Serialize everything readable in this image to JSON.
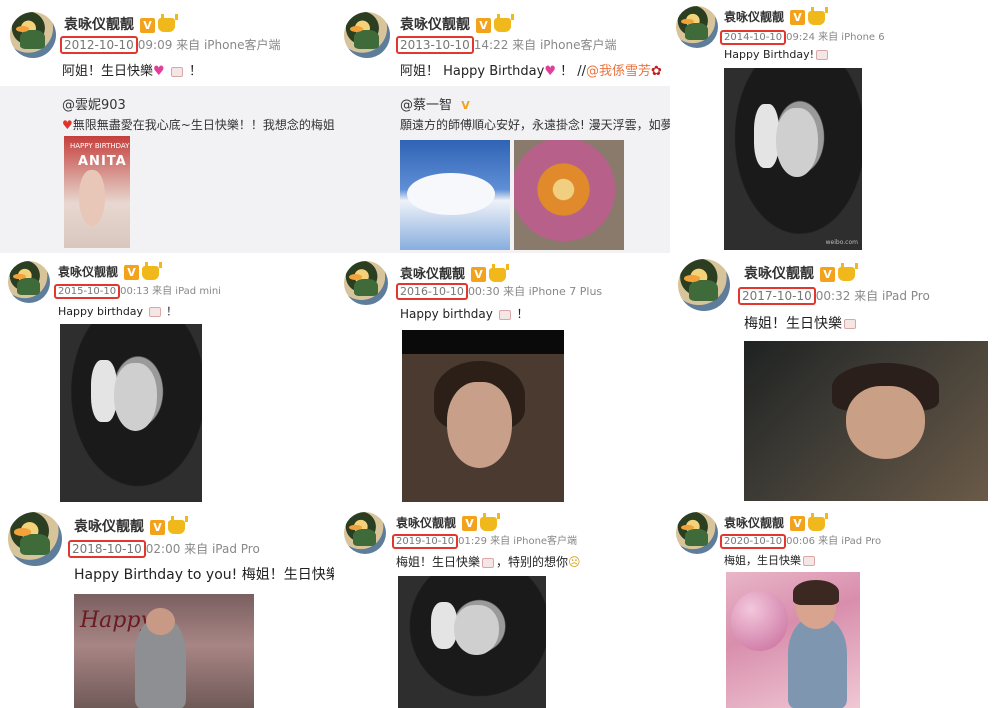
{
  "posts": [
    {
      "username": "袁咏仪靓靓",
      "date": "2012-10-10",
      "time_source": "09:09 来自 iPhone客户端",
      "text": "阿姐！生日快樂",
      "text_tail": "！",
      "repost": {
        "user": "@雲妮903",
        "text": "無限無盡愛在我心底~生日快樂！！我想念的梅姐",
        "image_label_small": "HAPPY BIRTHDAY",
        "image_label_big": "ANITA"
      }
    },
    {
      "username": "袁咏仪靓靓",
      "date": "2013-10-10",
      "time_source": "14:22 来自 iPhone客户端",
      "text": "阿姐！ Happy Birthday",
      "text_tail": "！ //",
      "mention": "@我係雪芳",
      "repost": {
        "user": "@蔡一智",
        "text": "願遠方的師傅順心安好，永遠掛念! 漫天浮雲，如夢"
      }
    },
    {
      "username": "袁咏仪靓靓",
      "date": "2014-10-10",
      "time_source": "09:24 来自 iPhone 6",
      "text": "Happy Birthday!",
      "watermark": "weibo.com"
    },
    {
      "username": "袁咏仪靓靓",
      "date": "2015-10-10",
      "time_source": "00:13 来自 iPad mini",
      "text": "Happy birthday",
      "text_tail": "！"
    },
    {
      "username": "袁咏仪靓靓",
      "date": "2016-10-10",
      "time_source": "00:30 来自 iPhone 7 Plus",
      "text": "Happy birthday",
      "text_tail": "！"
    },
    {
      "username": "袁咏仪靓靓",
      "date": "2017-10-10",
      "time_source": "00:32 来自 iPad Pro",
      "text": "梅姐！生日快樂"
    },
    {
      "username": "袁咏仪靓靓",
      "date": "2018-10-10",
      "time_source": "02:00 来自 iPad Pro",
      "text": "Happy Birthday to you! 梅姐！生日快樂",
      "image_sign": "Happy"
    },
    {
      "username": "袁咏仪靓靓",
      "date": "2019-10-10",
      "time_source": "01:29 来自 iPhone客户端",
      "text": "梅姐！生日快樂",
      "text_tail": "，特别的想你"
    },
    {
      "username": "袁咏仪靓靓",
      "date": "2020-10-10",
      "time_source": "00:06 来自 iPad Pro",
      "text": "梅姐，生日快樂"
    }
  ],
  "badges": {
    "verified_label": "V",
    "accent": "#e2372f",
    "verified_color": "#f3a21c"
  },
  "icons": [
    "avatar",
    "verified-icon",
    "crown-icon",
    "cake-emoji-icon",
    "heart-emoji-icon",
    "rose-emoji-icon"
  ]
}
